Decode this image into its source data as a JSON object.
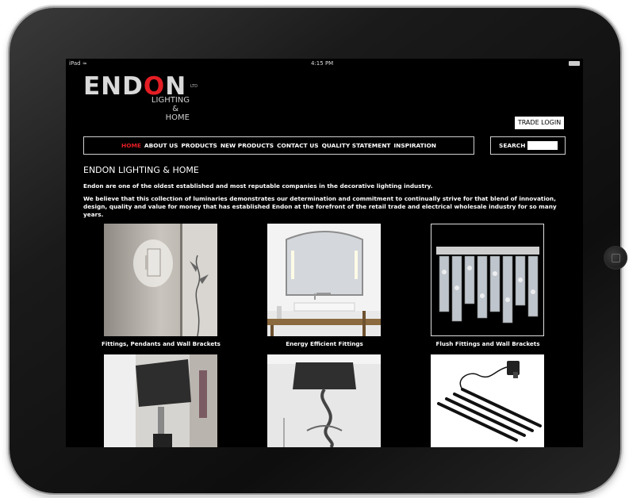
{
  "device": {
    "status_left": "iPad",
    "status_time": "4:15 PM"
  },
  "logo": {
    "main_prefix": "END",
    "main_o": "O",
    "main_suffix": "N",
    "ltd": "LTD",
    "sub_line1": "LIGHTING",
    "sub_line2": "&",
    "sub_line3": "HOME"
  },
  "header": {
    "trade_login": "TRADE LOGIN",
    "search_label": "SEARCH"
  },
  "nav": {
    "items": [
      "HOME",
      "ABOUT US",
      "PRODUCTS",
      "NEW PRODUCTS",
      "CONTACT US",
      "QUALITY STATEMENT",
      "INSPIRATION"
    ],
    "active_color": "#e31e24"
  },
  "content": {
    "title": "ENDON LIGHTING & HOME",
    "intro": "Endon are one of the oldest established and most reputable companies in the decorative lighting industry.",
    "para2": "We believe that this collection of luminaries demonstrates our determination and commitment to continually strive for that blend of innovation, design, quality and value for money that has established Endon at the forefront of the retail trade and electrical wholesale industry for so many years."
  },
  "products": [
    {
      "caption": "Fittings, Pendants and Wall Brackets"
    },
    {
      "caption": "Energy Efficient Fittings"
    },
    {
      "caption": "Flush Fittings and Wall Brackets"
    }
  ]
}
